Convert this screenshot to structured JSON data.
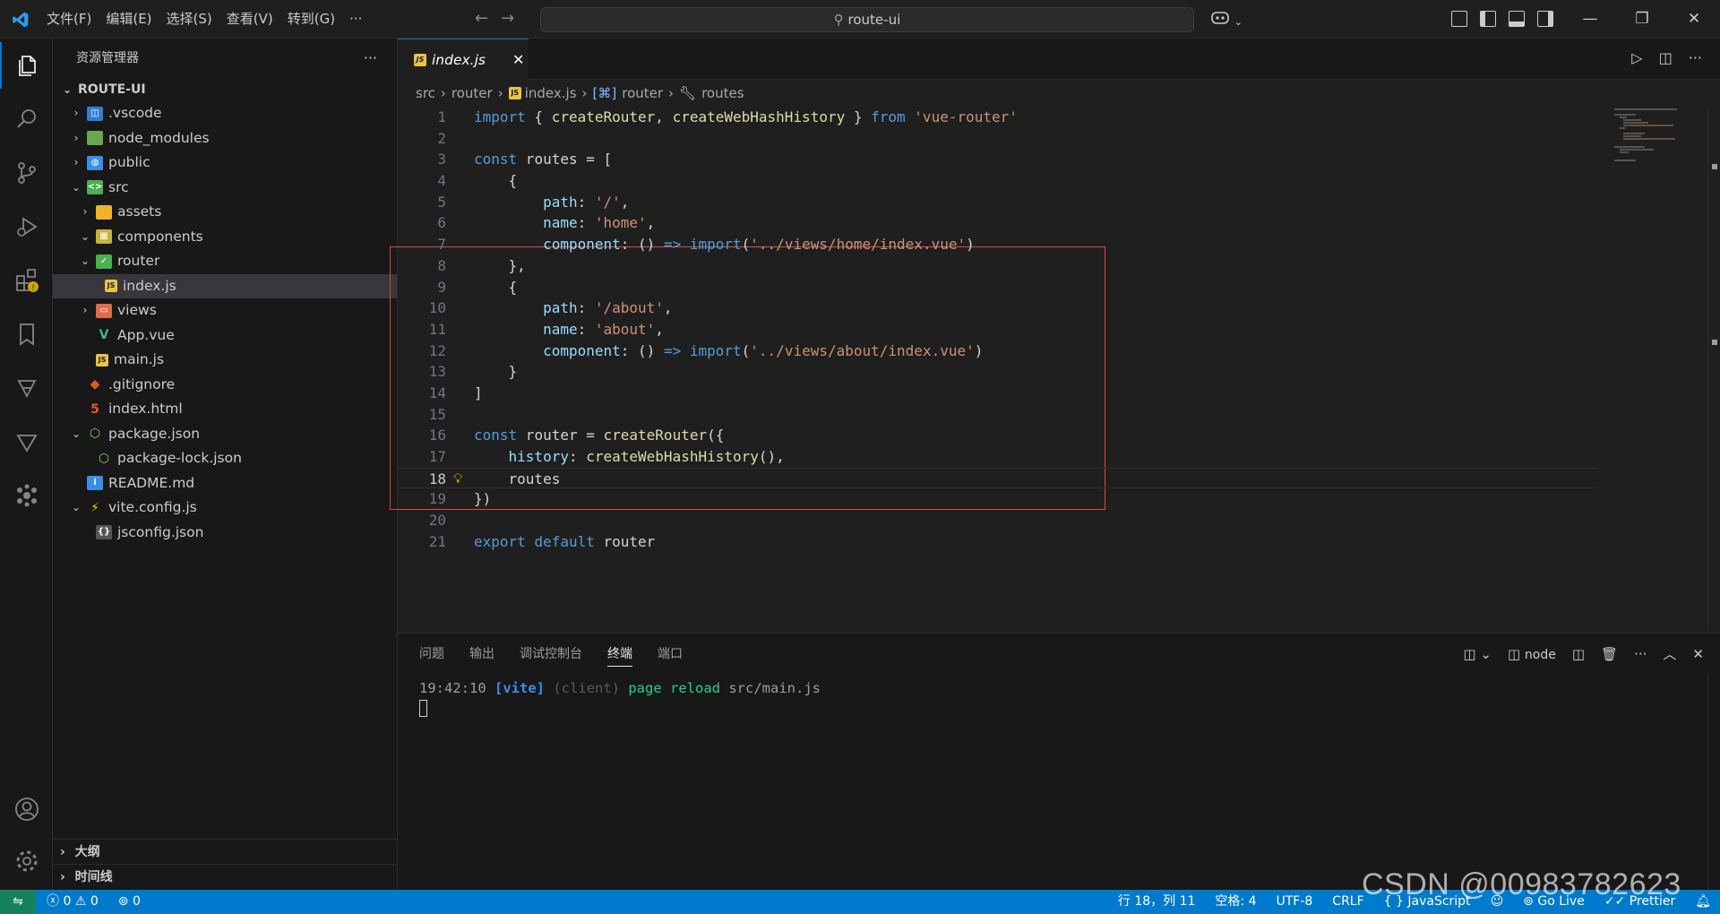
{
  "titlebar": {
    "menu": [
      "文件(F)",
      "编辑(E)",
      "选择(S)",
      "查看(V)",
      "转到(G)",
      "···"
    ],
    "search": "route-ui",
    "controls": {
      "minimize": "—",
      "restore": "❐",
      "close": "✕"
    }
  },
  "sidebar": {
    "title": "资源管理器",
    "more": "···",
    "root": "ROUTE-UI",
    "tree": [
      {
        "label": ".vscode",
        "chev": "›",
        "icon": "vscode-folder-icon"
      },
      {
        "label": "node_modules",
        "chev": "›",
        "icon": "node-folder-icon"
      },
      {
        "label": "public",
        "chev": "›",
        "icon": "public-folder-icon"
      },
      {
        "label": "src",
        "chev": "⌄",
        "icon": "src-folder-icon"
      },
      {
        "label": "assets",
        "chev": "›",
        "icon": "assets-folder-icon"
      },
      {
        "label": "components",
        "chev": "⌄",
        "icon": "components-folder-icon"
      },
      {
        "label": "router",
        "chev": "⌄",
        "icon": "router-folder-icon"
      },
      {
        "label": "index.js",
        "chev": "",
        "icon": "js-file-icon"
      },
      {
        "label": "views",
        "chev": "›",
        "icon": "views-folder-icon"
      },
      {
        "label": "App.vue",
        "chev": "",
        "icon": "vue-file-icon"
      },
      {
        "label": "main.js",
        "chev": "",
        "icon": "js-file-icon"
      },
      {
        "label": ".gitignore",
        "chev": "",
        "icon": "git-file-icon"
      },
      {
        "label": "index.html",
        "chev": "",
        "icon": "html-file-icon"
      },
      {
        "label": "package.json",
        "chev": "⌄",
        "icon": "node-json-icon"
      },
      {
        "label": "package-lock.json",
        "chev": "",
        "icon": "node-json-icon"
      },
      {
        "label": "README.md",
        "chev": "",
        "icon": "info-file-icon"
      },
      {
        "label": "vite.config.js",
        "chev": "⌄",
        "icon": "vite-file-icon"
      },
      {
        "label": "jsconfig.json",
        "chev": "",
        "icon": "json-file-icon"
      }
    ],
    "outline": "大纲",
    "timeline": "时间线"
  },
  "editor": {
    "tab": {
      "label": "index.js",
      "close": "✕"
    },
    "breadcrumb": [
      "src",
      "router",
      "index.js",
      "router",
      "routes"
    ],
    "lines": [
      {
        "n": "1",
        "t": "import { createRouter, createWebHashHistory } from 'vue-router'"
      },
      {
        "n": "2",
        "t": ""
      },
      {
        "n": "3",
        "t": "const routes = ["
      },
      {
        "n": "4",
        "t": "    {"
      },
      {
        "n": "5",
        "t": "        path: '/',"
      },
      {
        "n": "6",
        "t": "        name: 'home',"
      },
      {
        "n": "7",
        "t": "        component: () => import('../views/home/index.vue')"
      },
      {
        "n": "8",
        "t": "    },"
      },
      {
        "n": "9",
        "t": "    {"
      },
      {
        "n": "10",
        "t": "        path: '/about',"
      },
      {
        "n": "11",
        "t": "        name: 'about',"
      },
      {
        "n": "12",
        "t": "        component: () => import('../views/about/index.vue')"
      },
      {
        "n": "13",
        "t": "    }"
      },
      {
        "n": "14",
        "t": "]"
      },
      {
        "n": "15",
        "t": ""
      },
      {
        "n": "16",
        "t": "const router = createRouter({"
      },
      {
        "n": "17",
        "t": "    history: createWebHashHistory(),"
      },
      {
        "n": "18",
        "t": "    routes"
      },
      {
        "n": "19",
        "t": "})"
      },
      {
        "n": "20",
        "t": ""
      },
      {
        "n": "21",
        "t": "export default router"
      }
    ],
    "current_line": "18"
  },
  "panel": {
    "tabs": [
      "问题",
      "输出",
      "调试控制台",
      "终端",
      "端口"
    ],
    "active_tab": "终端",
    "terminal_name": "node",
    "log": {
      "time": "19:42:10",
      "tag": "[vite]",
      "source": "(client)",
      "message": "page reload",
      "file": "src/main.js"
    }
  },
  "statusbar": {
    "errors": "0",
    "warnings": "0",
    "ports": "0",
    "position": "行 18，列 11",
    "spaces": "空格: 4",
    "encoding": "UTF-8",
    "eol": "CRLF",
    "language": "{ } JavaScript",
    "golive": "Go Live",
    "prettier": "✓✓ Prettier"
  },
  "watermark": "CSDN @00983782623",
  "colors": {
    "accent": "#007acc",
    "keyword": "#569cd6",
    "string": "#ce9178",
    "function": "#dcdcaa",
    "variable": "#9cdcfe",
    "redbox": "#e04848"
  }
}
